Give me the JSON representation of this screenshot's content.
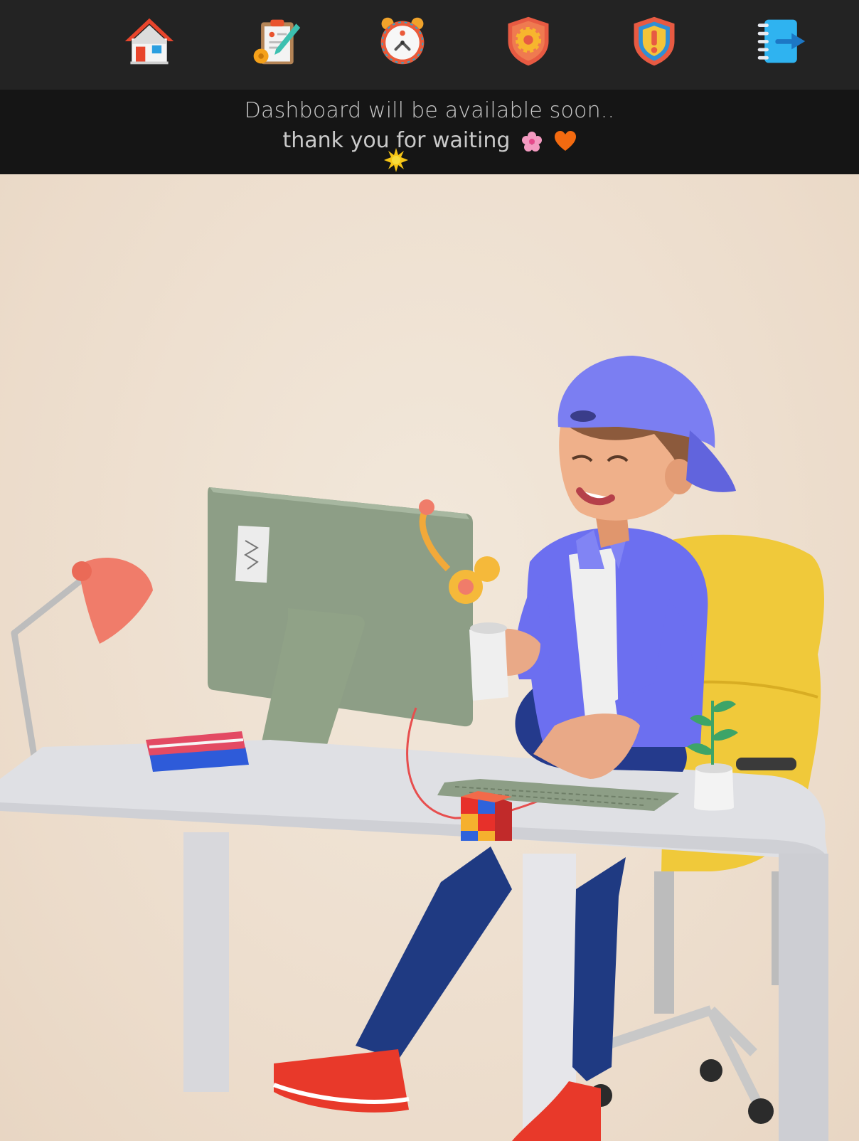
{
  "nav": {
    "items": [
      {
        "name": "home",
        "icon": "home-icon"
      },
      {
        "name": "tasks",
        "icon": "clipboard-settings-icon"
      },
      {
        "name": "reminders",
        "icon": "alarm-clock-icon"
      },
      {
        "name": "settings",
        "icon": "shield-gear-icon"
      },
      {
        "name": "alerts",
        "icon": "shield-alert-icon"
      },
      {
        "name": "logout",
        "icon": "logout-icon"
      }
    ]
  },
  "notice": {
    "line1": "Dashboard will be available soon..",
    "line2": "thank you for waiting"
  },
  "colors": {
    "nav_bg": "#232323",
    "notice_bg": "#151515",
    "notice_text": "#c9c9c9",
    "hero_bg": "#efe3d6"
  }
}
